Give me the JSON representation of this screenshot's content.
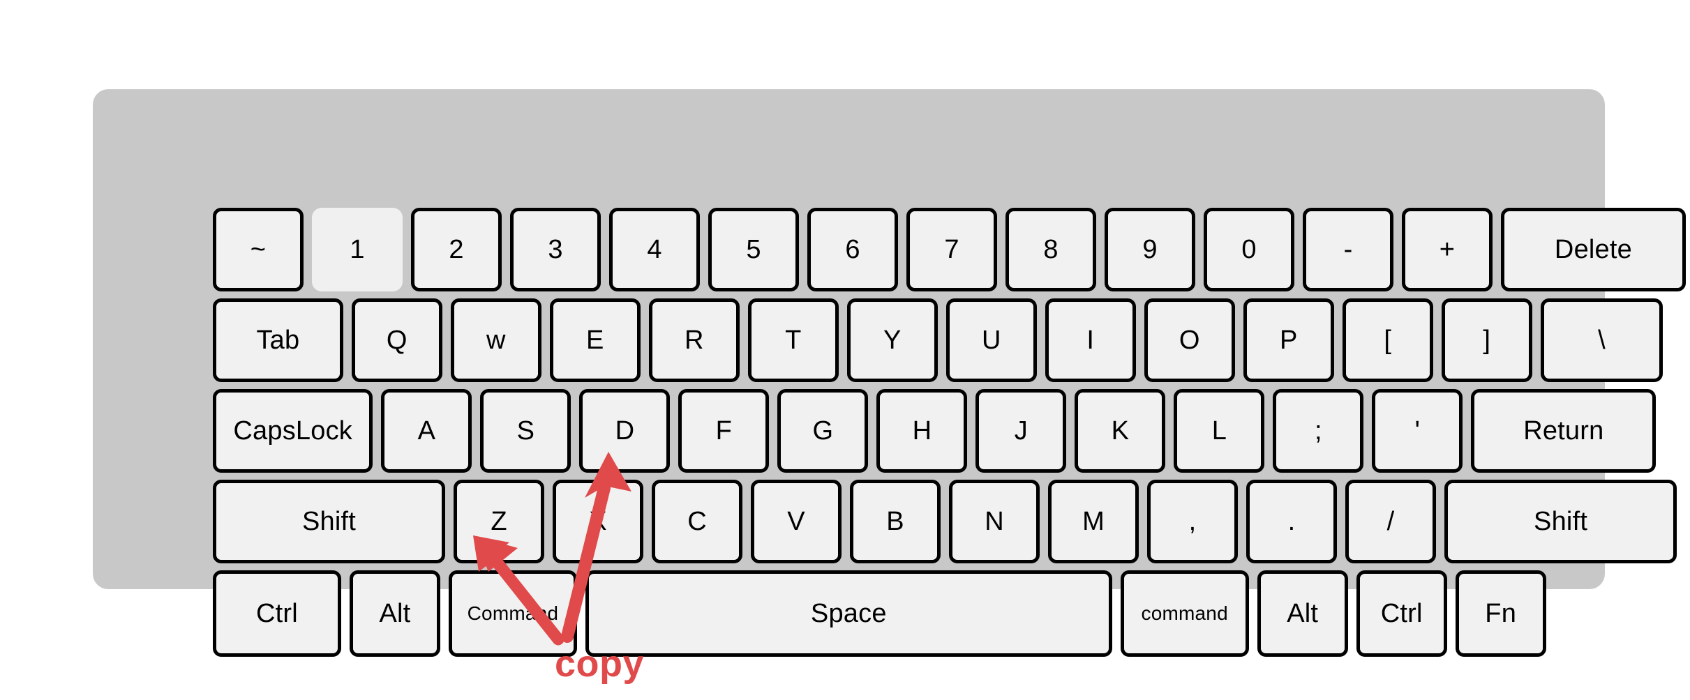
{
  "diagram": {
    "title": "keyboard-shortcut-diagram",
    "body_color": "#c8c8c8",
    "key_face_color": "#f1f1f1",
    "key_border_color": "#000000",
    "annotation_color": "#e04a4a",
    "background_color": "#ffffff"
  },
  "annotation": {
    "label": "copy",
    "color": "#e04a4a",
    "arrows": [
      {
        "name": "arrow-to-command",
        "points_to": "Command",
        "tail": [
          800,
          915
        ],
        "tip": [
          678,
          768
        ]
      },
      {
        "name": "arrow-to-c",
        "points_to": "C",
        "tail": [
          813,
          913
        ],
        "tip": [
          872,
          648
        ]
      }
    ]
  },
  "keyboard": {
    "rows": [
      {
        "name": "number-row",
        "keys": [
          {
            "label": "~",
            "units": 1,
            "style": "bordered"
          },
          {
            "label": "1",
            "units": 1,
            "style": "borderless"
          },
          {
            "label": "2",
            "units": 1,
            "style": "bordered"
          },
          {
            "label": "3",
            "units": 1,
            "style": "bordered"
          },
          {
            "label": "4",
            "units": 1,
            "style": "bordered"
          },
          {
            "label": "5",
            "units": 1,
            "style": "bordered"
          },
          {
            "label": "6",
            "units": 1,
            "style": "bordered"
          },
          {
            "label": "7",
            "units": 1,
            "style": "bordered"
          },
          {
            "label": "8",
            "units": 1,
            "style": "bordered"
          },
          {
            "label": "9",
            "units": 1,
            "style": "bordered"
          },
          {
            "label": "0",
            "units": 1,
            "style": "bordered"
          },
          {
            "label": "-",
            "units": 1,
            "style": "bordered"
          },
          {
            "label": "+",
            "units": 1,
            "style": "bordered"
          },
          {
            "label": "Delete",
            "units": 1.95,
            "style": "bordered"
          }
        ]
      },
      {
        "name": "qwerty-row",
        "keys": [
          {
            "label": "Tab",
            "units": 1.4,
            "style": "bordered"
          },
          {
            "label": "Q",
            "units": 1,
            "style": "bordered"
          },
          {
            "label": "w",
            "units": 1,
            "style": "bordered"
          },
          {
            "label": "E",
            "units": 1,
            "style": "bordered"
          },
          {
            "label": "R",
            "units": 1,
            "style": "bordered"
          },
          {
            "label": "T",
            "units": 1,
            "style": "bordered"
          },
          {
            "label": "Y",
            "units": 1,
            "style": "bordered"
          },
          {
            "label": "U",
            "units": 1,
            "style": "bordered"
          },
          {
            "label": "I",
            "units": 1,
            "style": "bordered"
          },
          {
            "label": "O",
            "units": 1,
            "style": "bordered"
          },
          {
            "label": "P",
            "units": 1,
            "style": "bordered"
          },
          {
            "label": "[",
            "units": 1,
            "style": "bordered"
          },
          {
            "label": "]",
            "units": 1,
            "style": "bordered"
          },
          {
            "label": "\\",
            "units": 1.32,
            "style": "bordered"
          }
        ]
      },
      {
        "name": "home-row",
        "keys": [
          {
            "label": "CapsLock",
            "units": 1.7,
            "style": "bordered"
          },
          {
            "label": "A",
            "units": 1,
            "style": "bordered"
          },
          {
            "label": "S",
            "units": 1,
            "style": "bordered"
          },
          {
            "label": "D",
            "units": 1,
            "style": "bordered"
          },
          {
            "label": "F",
            "units": 1,
            "style": "bordered"
          },
          {
            "label": "G",
            "units": 1,
            "style": "bordered"
          },
          {
            "label": "H",
            "units": 1,
            "style": "bordered"
          },
          {
            "label": "J",
            "units": 1,
            "style": "bordered"
          },
          {
            "label": "K",
            "units": 1,
            "style": "bordered"
          },
          {
            "label": "L",
            "units": 1,
            "style": "bordered"
          },
          {
            "label": ";",
            "units": 1,
            "style": "bordered"
          },
          {
            "label": "'",
            "units": 1,
            "style": "bordered"
          },
          {
            "label": "Return",
            "units": 1.95,
            "style": "bordered"
          }
        ]
      },
      {
        "name": "shift-row",
        "keys": [
          {
            "label": "Shift",
            "units": 2.43,
            "style": "bordered"
          },
          {
            "label": "Z",
            "units": 1,
            "style": "bordered"
          },
          {
            "label": "X",
            "units": 1,
            "style": "bordered"
          },
          {
            "label": "C",
            "units": 1,
            "style": "bordered"
          },
          {
            "label": "V",
            "units": 1,
            "style": "bordered"
          },
          {
            "label": "B",
            "units": 1,
            "style": "bordered"
          },
          {
            "label": "N",
            "units": 1,
            "style": "bordered"
          },
          {
            "label": "M",
            "units": 1,
            "style": "bordered"
          },
          {
            "label": ",",
            "units": 1,
            "style": "bordered"
          },
          {
            "label": ".",
            "units": 1,
            "style": "bordered"
          },
          {
            "label": "/",
            "units": 1,
            "style": "bordered"
          },
          {
            "label": "Shift",
            "units": 2.43,
            "style": "bordered"
          }
        ]
      },
      {
        "name": "modifier-row",
        "keys": [
          {
            "label": "Ctrl",
            "units": 1.38,
            "style": "bordered"
          },
          {
            "label": "Alt",
            "units": 1,
            "style": "bordered"
          },
          {
            "label": "Command",
            "units": 1.38,
            "style": "bordered",
            "text": "small"
          },
          {
            "label": "Space",
            "units": 5.4,
            "style": "bordered"
          },
          {
            "label": "command",
            "units": 1.38,
            "style": "bordered",
            "text": "small"
          },
          {
            "label": "Alt",
            "units": 1,
            "style": "bordered"
          },
          {
            "label": "Ctrl",
            "units": 1,
            "style": "bordered"
          },
          {
            "label": "Fn",
            "units": 1,
            "style": "bordered"
          }
        ]
      }
    ]
  }
}
